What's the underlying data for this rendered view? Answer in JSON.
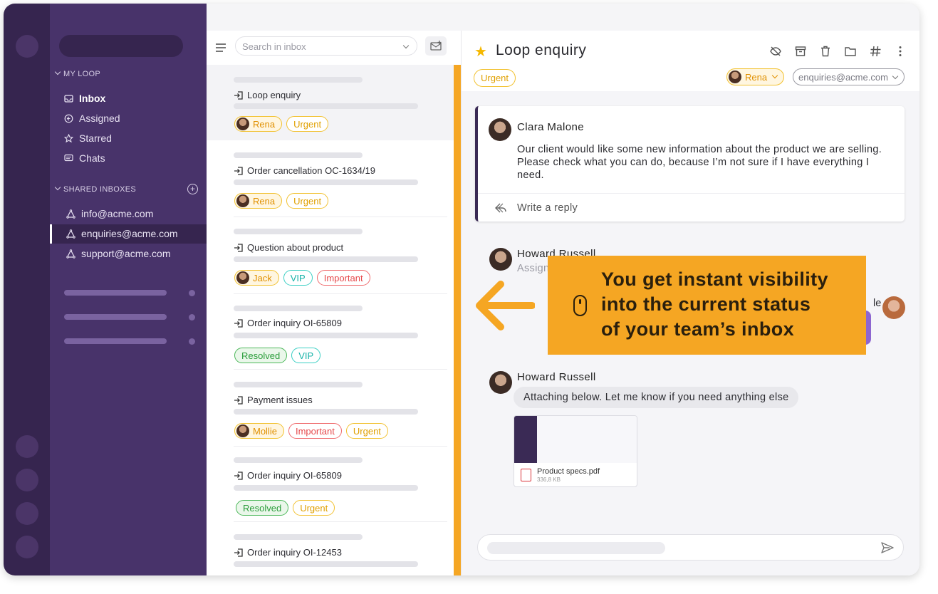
{
  "nav": {
    "my_loop_label": "MY LOOP",
    "my_loop_items": [
      {
        "label": "Inbox",
        "icon": "inbox-icon"
      },
      {
        "label": "Assigned",
        "icon": "assigned-icon"
      },
      {
        "label": "Starred",
        "icon": "star-icon"
      },
      {
        "label": "Chats",
        "icon": "chat-icon"
      }
    ],
    "shared_label": "SHARED INBOXES",
    "shared_items": [
      {
        "label": "info@acme.com"
      },
      {
        "label": "enquiries@acme.com",
        "selected": true
      },
      {
        "label": "support@acme.com"
      }
    ]
  },
  "list": {
    "search_placeholder": "Search in inbox",
    "conversations": [
      {
        "subject": "Loop enquiry",
        "tags": [
          {
            "label": "Rena",
            "kind": "user"
          },
          {
            "label": "Urgent",
            "kind": "urgent"
          }
        ]
      },
      {
        "subject": "Order cancellation OC-1634/19",
        "tags": [
          {
            "label": "Rena",
            "kind": "user"
          },
          {
            "label": "Urgent",
            "kind": "urgent"
          }
        ]
      },
      {
        "subject": "Question about product",
        "tags": [
          {
            "label": "Jack",
            "kind": "user"
          },
          {
            "label": "VIP",
            "kind": "vip"
          },
          {
            "label": "Important",
            "kind": "important"
          }
        ]
      },
      {
        "subject": "Order inquiry OI-65809",
        "tags": [
          {
            "label": "Resolved",
            "kind": "resolved"
          },
          {
            "label": "VIP",
            "kind": "vip"
          }
        ]
      },
      {
        "subject": "Payment issues",
        "tags": [
          {
            "label": "Mollie",
            "kind": "user"
          },
          {
            "label": "Important",
            "kind": "important"
          },
          {
            "label": "Urgent",
            "kind": "urgent"
          }
        ]
      },
      {
        "subject": "Order inquiry OI-65809",
        "tags": [
          {
            "label": "Resolved",
            "kind": "resolved"
          },
          {
            "label": "Urgent",
            "kind": "urgent"
          }
        ]
      },
      {
        "subject": "Order inquiry OI-12453",
        "tags": []
      }
    ]
  },
  "main": {
    "title": "Loop enquiry",
    "tag": "Urgent",
    "assignee": "Rena",
    "inbox": "enquiries@acme.com",
    "first_message": {
      "sender": "Clara Malone",
      "body": "Our client would like some new information about the product we are selling. Please check what you can do, because I’m not sure if I have everything I need.",
      "reply_label": "Write a reply"
    },
    "second_message": {
      "sender": "Howard Russell",
      "preview": "Assign",
      "partial_label": "le"
    },
    "third_message": {
      "sender": "Howard Russell",
      "body": "Attaching below. Let me know if you need anything else",
      "attachment_name": "Product specs.pdf",
      "attachment_size": "336,8 KB"
    }
  },
  "callout": {
    "line1": "You get instant visibility",
    "line2": "into the current status",
    "line3": "of your team’s inbox"
  },
  "colors": {
    "accent": "#f5a623",
    "sidebar": "#48336a",
    "rail": "#36254f"
  }
}
